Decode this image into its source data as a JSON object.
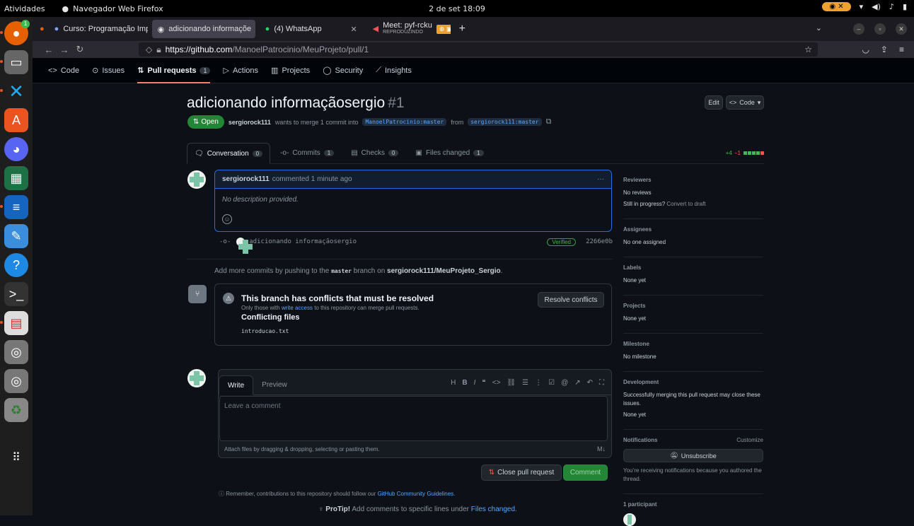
{
  "os": {
    "activities": "Atividades",
    "app_name": "Navegador Web Firefox",
    "clock": "2 de set  18:09"
  },
  "browser": {
    "tabs": [
      {
        "label": "Curso: Programação Imp",
        "icon": "globe-icon"
      },
      {
        "label": "adicionando informaçõe",
        "icon": "github-icon"
      },
      {
        "label": "(4) WhatsApp",
        "icon": "whatsapp-icon"
      },
      {
        "label": "Meet: pyf-rcku",
        "sub": "REPRODUZINDO",
        "icon": "meet-icon"
      }
    ],
    "url_host": "https://github.com",
    "url_path": "/ManoelPatrocinio/MeuProjeto/pull/1"
  },
  "repo_nav": {
    "code": "Code",
    "issues": "Issues",
    "pulls": "Pull requests",
    "pulls_count": "1",
    "actions": "Actions",
    "projects": "Projects",
    "security": "Security",
    "insights": "Insights"
  },
  "pr": {
    "title": "adicionando informaçãosergio",
    "number": "#1",
    "edit_label": "Edit",
    "code_label": "Code",
    "state": "Open",
    "author": "sergiorock111",
    "merge_text": "wants to merge 1 commit into",
    "base_branch": "ManoelPatrocinio:master",
    "from_text": "from",
    "head_branch": "sergiorock111:master"
  },
  "pr_tabs": {
    "conversation": "Conversation",
    "conversation_count": "0",
    "commits": "Commits",
    "commits_count": "1",
    "checks": "Checks",
    "checks_count": "0",
    "files": "Files changed",
    "files_count": "1",
    "additions": "+4",
    "deletions": "−1"
  },
  "comment": {
    "author": "sergiorock111",
    "meta": "commented 1 minute ago",
    "menu": "···",
    "body": "No description provided.",
    "emoji": "☺"
  },
  "commit": {
    "message": "adicionando informaçãosergio",
    "verified": "Verified",
    "sha": "2266e0b"
  },
  "hint": {
    "prefix": "Add more commits by pushing to the",
    "branch": "master",
    "middle": "branch on",
    "repo": "sergiorock111/MeuProjeto_Sergio",
    "suffix": "."
  },
  "conflicts": {
    "title": "This branch has conflicts that must be resolved",
    "sub_prefix": "Only those with",
    "sub_link": "write access",
    "sub_suffix": "to this repository can merge pull requests.",
    "files_title": "Conflicting files",
    "file": "introducao.txt",
    "resolve_label": "Resolve conflicts"
  },
  "editor": {
    "write": "Write",
    "preview": "Preview",
    "placeholder": "Leave a comment",
    "attach": "Attach files by dragging & dropping, selecting or pasting them.",
    "close_label": "Close pull request",
    "comment_label": "Comment",
    "remember_prefix": "Remember, contributions to this repository should follow our",
    "remember_link": "GitHub Community Guidelines",
    "remember_suffix": ".",
    "protip_bold": "ProTip!",
    "protip_text": "Add comments to specific lines under",
    "protip_link": "Files changed",
    "protip_suffix": "."
  },
  "sidebar": {
    "reviewers_h": "Reviewers",
    "reviewers_v": "No reviews",
    "still_prefix": "Still in progress?",
    "still_link": "Convert to draft",
    "assignees_h": "Assignees",
    "assignees_v": "No one assigned",
    "labels_h": "Labels",
    "labels_v": "None yet",
    "projects_h": "Projects",
    "projects_v": "None yet",
    "milestone_h": "Milestone",
    "milestone_v": "No milestone",
    "development_h": "Development",
    "development_text": "Successfully merging this pull request may close these issues.",
    "development_v": "None yet",
    "notifications_h": "Notifications",
    "customize": "Customize",
    "unsubscribe": "Unsubscribe",
    "notif_text": "You’re receiving notifications because you authored the thread.",
    "participants": "1 participant"
  },
  "colors": {
    "accent_green": "#238636",
    "link_blue": "#58a6ff",
    "danger": "#f85149"
  }
}
